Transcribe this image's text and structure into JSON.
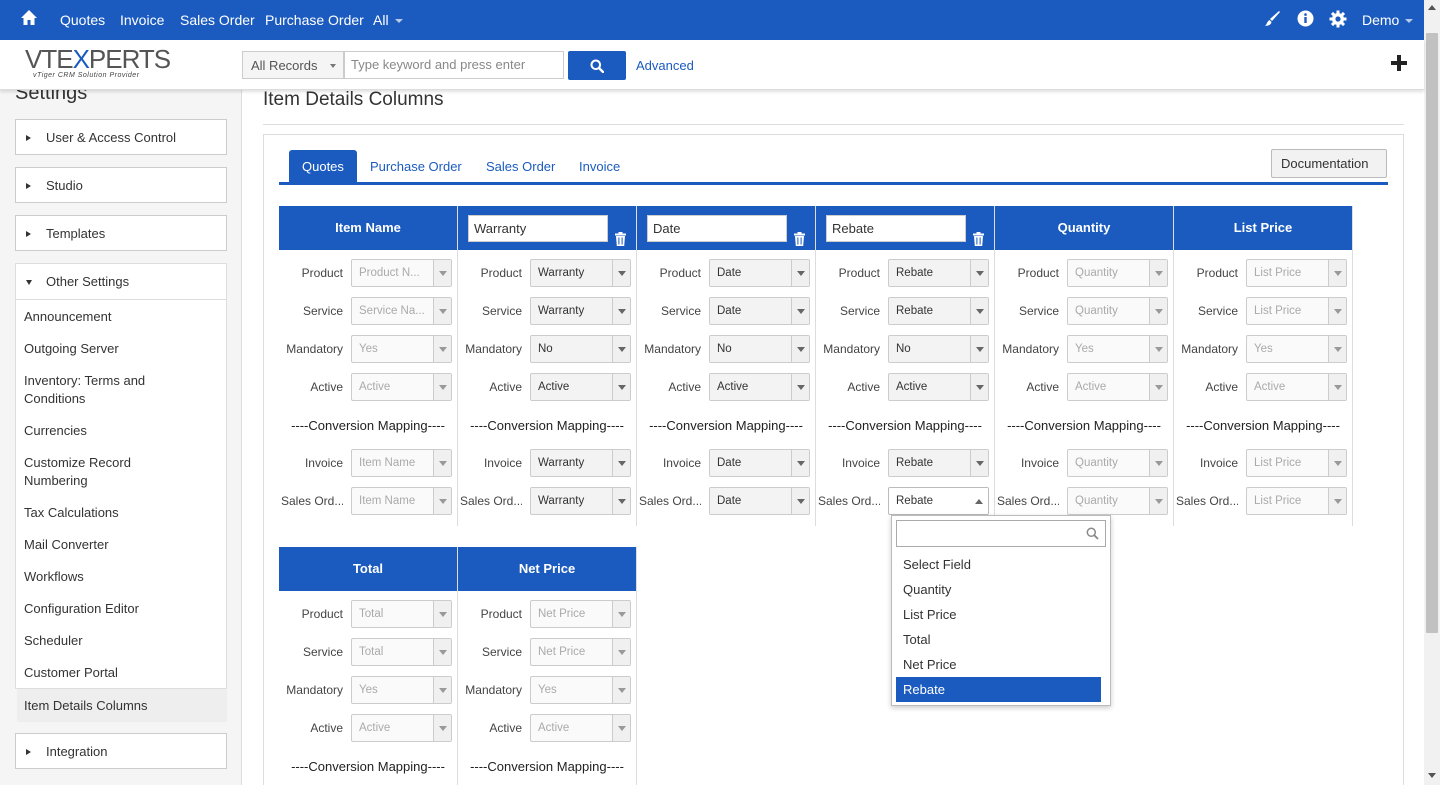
{
  "topnav": {
    "items": [
      "Quotes",
      "Invoice",
      "Sales Order",
      "Purchase Order",
      "All"
    ],
    "user": "Demo",
    "icons": [
      "home-icon",
      "brush-icon",
      "info-icon",
      "gear-icon"
    ]
  },
  "header": {
    "logo_main": "VTEXPERTS",
    "logo_sub": "vTiger CRM Solution Provider",
    "records_select": "All Records",
    "search_placeholder": "Type keyword and press enter",
    "advanced_label": "Advanced"
  },
  "sidebar": {
    "title": "Settings",
    "sections": [
      "User & Access Control",
      "Studio",
      "Templates",
      "Other Settings",
      "Integration"
    ],
    "links": [
      "Announcement",
      "Outgoing Server",
      "Inventory: Terms and Conditions",
      "Currencies",
      "Customize Record Numbering",
      "Tax Calculations",
      "Mail Converter",
      "Workflows",
      "Configuration Editor",
      "Scheduler",
      "Customer Portal",
      "Item Details Columns"
    ]
  },
  "main": {
    "title": "Item Details Columns",
    "tabs": [
      "Quotes",
      "Purchase Order",
      "Sales Order",
      "Invoice"
    ],
    "documentation_label": "Documentation",
    "conversion_label": "----Conversion Mapping----",
    "columns": [
      {
        "header": "Item Name",
        "editable": false,
        "product": "Product N...",
        "service": "Service Na...",
        "mandatory": "Yes",
        "active": "Active",
        "invoice": "Item Name",
        "sales_order": "Item Name"
      },
      {
        "header": "Warranty",
        "editable": true,
        "product": "Warranty",
        "service": "Warranty",
        "mandatory": "No",
        "active": "Active",
        "invoice": "Warranty",
        "sales_order": "Warranty"
      },
      {
        "header": "Date",
        "editable": true,
        "product": "Date",
        "service": "Date",
        "mandatory": "No",
        "active": "Active",
        "invoice": "Date",
        "sales_order": "Date"
      },
      {
        "header": "Rebate",
        "editable": true,
        "product": "Rebate",
        "service": "Rebate",
        "mandatory": "No",
        "active": "Active",
        "invoice": "Rebate",
        "sales_order": "Rebate"
      },
      {
        "header": "Quantity",
        "editable": false,
        "product": "Quantity",
        "service": "Quantity",
        "mandatory": "Yes",
        "active": "Active",
        "invoice": "Quantity",
        "sales_order": "Quantity"
      },
      {
        "header": "List Price",
        "editable": false,
        "product": "List Price",
        "service": "List Price",
        "mandatory": "Yes",
        "active": "Active",
        "invoice": "List Price",
        "sales_order": "List Price"
      },
      {
        "header": "Total",
        "editable": false,
        "product": "Total",
        "service": "Total",
        "mandatory": "Yes",
        "active": "Active"
      },
      {
        "header": "Net Price",
        "editable": false,
        "product": "Net Price",
        "service": "Net Price",
        "mandatory": "Yes",
        "active": "Active"
      }
    ],
    "row_labels": {
      "product": "Product",
      "service": "Service",
      "mandatory": "Mandatory",
      "active": "Active",
      "invoice": "Invoice",
      "sales_order": "Sales Ord..."
    }
  },
  "dropdown": {
    "options": [
      "Select Field",
      "Quantity",
      "List Price",
      "Total",
      "Net Price",
      "Rebate"
    ],
    "selected": "Rebate"
  },
  "colors": {
    "primary": "#1b5bbf",
    "background": "#f5f5f5"
  }
}
